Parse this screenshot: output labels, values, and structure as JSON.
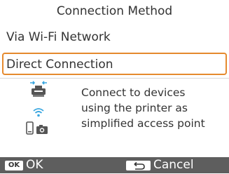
{
  "screen": {
    "title": "Connection Method",
    "options": [
      {
        "label": "Via Wi-Fi Network",
        "selected": false
      },
      {
        "label": "Direct Connection",
        "selected": true
      }
    ],
    "description_lines": [
      "Connect to devices",
      "using the printer as",
      "simplified access point"
    ],
    "icons": [
      "printer-icon",
      "wifi-icon",
      "phone-icon",
      "camera-icon"
    ]
  },
  "footer": {
    "ok_key": "OK",
    "ok_label": "OK",
    "cancel_label": "Cancel"
  },
  "colors": {
    "accent": "#e58a2e",
    "footer_bg": "#5e5e5e",
    "wifi": "#3aa7e0"
  }
}
